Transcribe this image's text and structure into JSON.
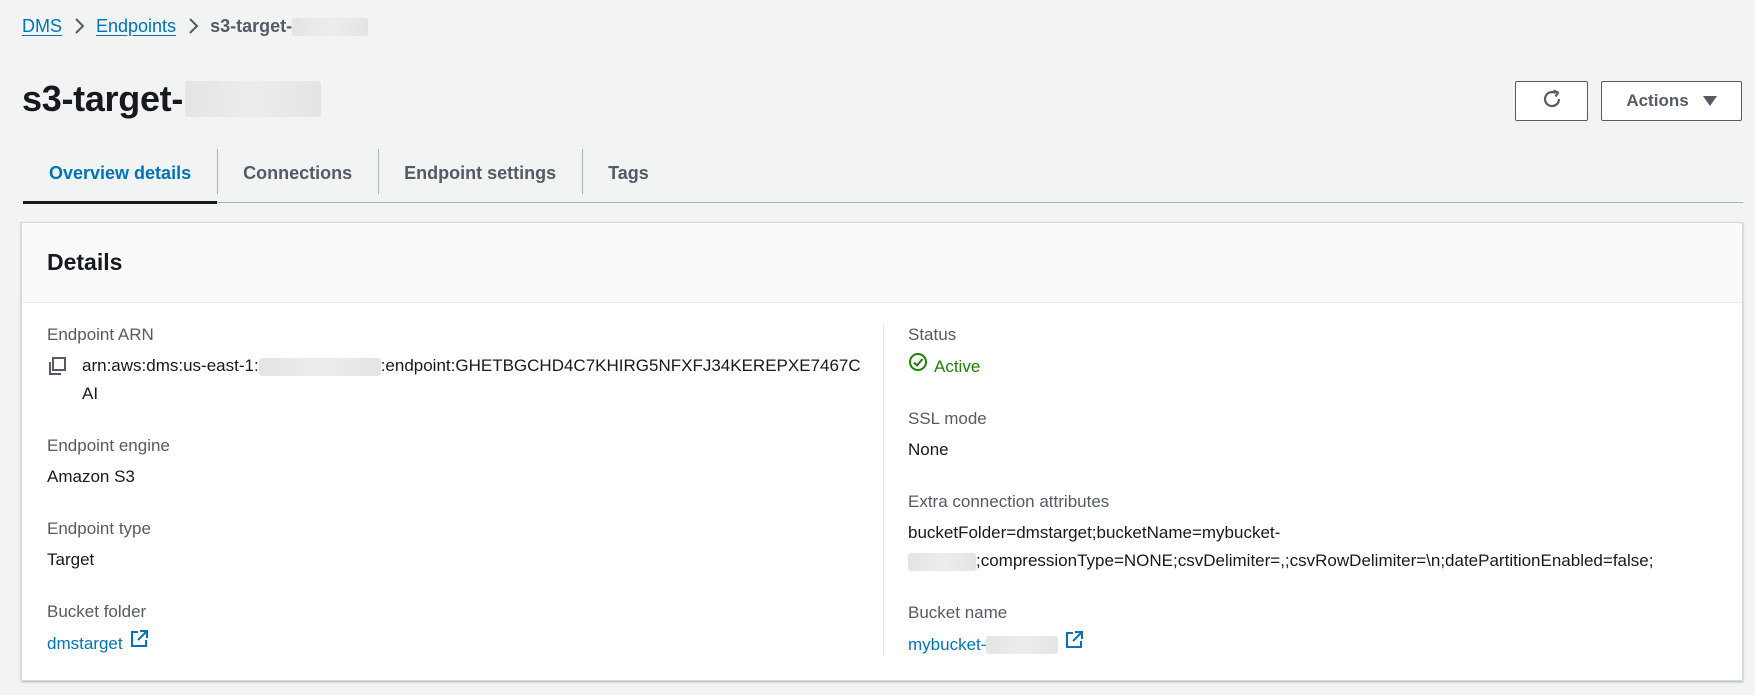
{
  "breadcrumb": {
    "items": [
      "DMS",
      "Endpoints"
    ],
    "current": "s3-target-"
  },
  "title": "s3-target-",
  "header": {
    "actions_label": "Actions"
  },
  "tabs": [
    {
      "label": "Overview details",
      "active": true
    },
    {
      "label": "Connections",
      "active": false
    },
    {
      "label": "Endpoint settings",
      "active": false
    },
    {
      "label": "Tags",
      "active": false
    }
  ],
  "details": {
    "heading": "Details",
    "endpoint_arn": {
      "label": "Endpoint ARN",
      "prefix": "arn:aws:dms:us-east-1:",
      "suffix": ":endpoint:GHETBGCHD4C7KHIRG5NFXFJ34KEREPXE7467CAI"
    },
    "endpoint_engine": {
      "label": "Endpoint engine",
      "value": "Amazon S3"
    },
    "endpoint_type": {
      "label": "Endpoint type",
      "value": "Target"
    },
    "bucket_folder": {
      "label": "Bucket folder",
      "value": "dmstarget"
    },
    "status": {
      "label": "Status",
      "value": "Active",
      "color": "#1d8102"
    },
    "ssl_mode": {
      "label": "SSL mode",
      "value": "None"
    },
    "extra_attributes": {
      "label": "Extra connection attributes",
      "line1": "bucketFolder=dmstarget;bucketName=mybucket-",
      "line2": ";compressionType=NONE;csvDelimiter=,;csvRowDelimiter=\\n;datePartitionEnabled=false;"
    },
    "bucket_name": {
      "label": "Bucket name",
      "value": "mybucket-"
    }
  },
  "colors": {
    "link": "#0073bb",
    "background": "#f2f3f3",
    "success": "#1d8102"
  }
}
